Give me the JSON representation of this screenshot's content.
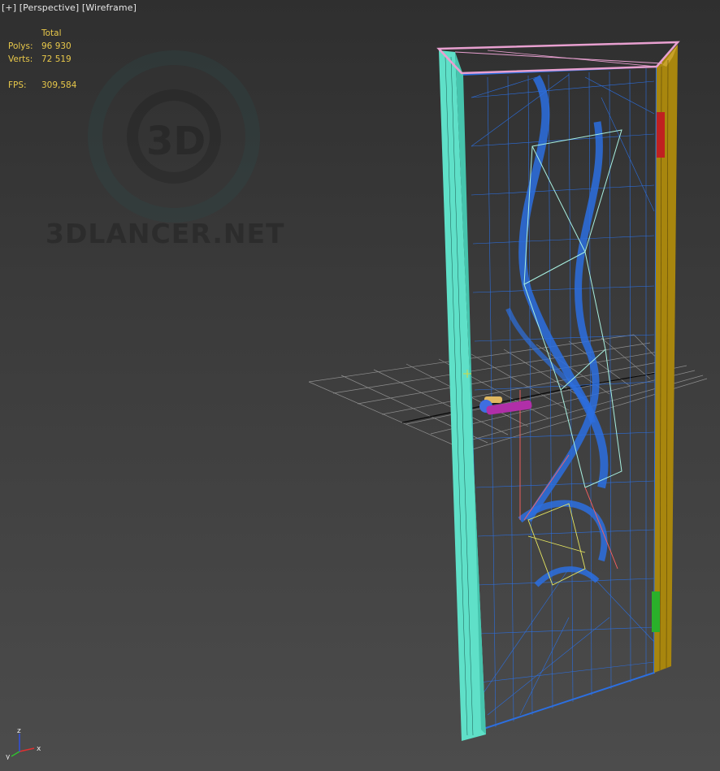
{
  "viewport": {
    "menu_label": "[+]",
    "view_label": "[Perspective]",
    "shading_label": "[Wireframe]"
  },
  "stats": {
    "header": "Total",
    "polys_label": "Polys:",
    "polys_value": "96 930",
    "verts_label": "Verts:",
    "verts_value": "72 519",
    "fps_label": "FPS:",
    "fps_value": "309,584"
  },
  "watermark": {
    "text": "3DLANCER.NET",
    "logo_text": "3D"
  },
  "gizmo": {
    "x_label": "x",
    "y_label": "y",
    "z_label": "z"
  },
  "colors": {
    "background": "#3b3b3b",
    "stats_text": "#e8c84a",
    "frame_left": "#5fe0c8",
    "frame_right": "#a8860e",
    "frame_top": "#e8a0d0",
    "door_wire": "#2a6ee0",
    "glass_outline": "#a8f0e0",
    "handle": "#b02fa8",
    "hinge_top": "#c02020",
    "hinge_bottom": "#2ab02a",
    "grid": "#8a8a8a"
  }
}
